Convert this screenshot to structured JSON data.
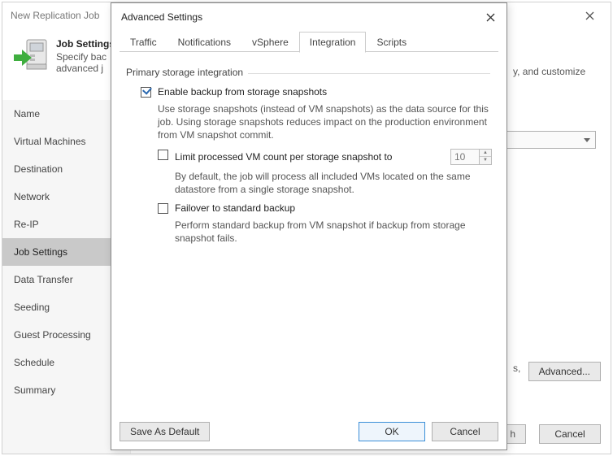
{
  "parent": {
    "title": "New Replication Job",
    "header_title": "Job Settings",
    "header_subtitle": "Specify backup repository, retention policy, and customize advanced job settings.",
    "trailing_text_line1": "y, and customize",
    "trailing_text_line2": "s,",
    "advanced_btn": "Advanced...",
    "finish_btn_partial": "h",
    "cancel_btn": "Cancel"
  },
  "sidebar": {
    "items": [
      {
        "label": "Name"
      },
      {
        "label": "Virtual Machines"
      },
      {
        "label": "Destination"
      },
      {
        "label": "Network"
      },
      {
        "label": "Re-IP"
      },
      {
        "label": "Job Settings"
      },
      {
        "label": "Data Transfer"
      },
      {
        "label": "Seeding"
      },
      {
        "label": "Guest Processing"
      },
      {
        "label": "Schedule"
      },
      {
        "label": "Summary"
      }
    ],
    "active_index": 5
  },
  "dialog": {
    "title": "Advanced Settings",
    "tabs": [
      "Traffic",
      "Notifications",
      "vSphere",
      "Integration",
      "Scripts"
    ],
    "active_tab": 3,
    "group_label": "Primary storage integration",
    "enable_label": "Enable backup from storage snapshots",
    "enable_checked": true,
    "enable_desc": "Use storage snapshots (instead of VM snapshots) as the data source for this job. Using storage snapshots reduces impact on the production environment from VM snapshot commit.",
    "limit_label": "Limit processed VM count per storage snapshot to",
    "limit_checked": false,
    "limit_value": "10",
    "limit_desc": "By default, the job will process all included VMs located on the same datastore from a single storage snapshot.",
    "failover_label": "Failover to standard backup",
    "failover_checked": false,
    "failover_desc": "Perform standard backup from VM snapshot if backup from storage snapshot fails.",
    "save_default_btn": "Save As Default",
    "ok_btn": "OK",
    "cancel_btn": "Cancel"
  }
}
